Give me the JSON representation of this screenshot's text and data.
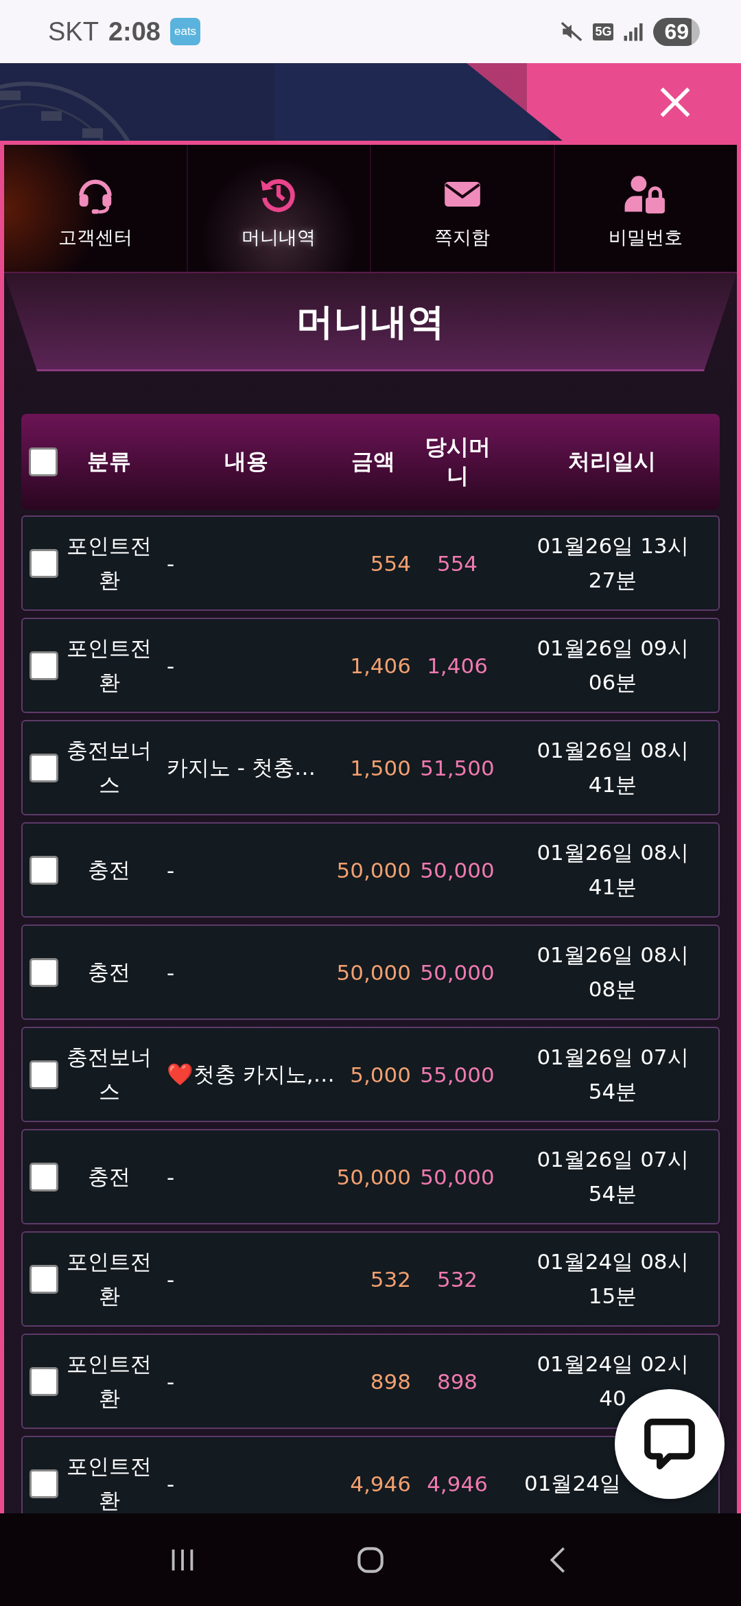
{
  "status_bar": {
    "carrier": "SKT",
    "time": "2:08",
    "app_badge": "eats",
    "network": "5G",
    "battery": "69"
  },
  "menu": [
    {
      "label": "고객센터",
      "selected": false
    },
    {
      "label": "머니내역",
      "selected": true
    },
    {
      "label": "쪽지함",
      "selected": false
    },
    {
      "label": "비밀번호",
      "selected": false
    }
  ],
  "title": "머니내역",
  "table": {
    "select_all": {
      "checked": false
    },
    "columns": [
      "분류",
      "내용",
      "금액",
      "당시머니",
      "처리일시"
    ],
    "rows": [
      {
        "checked": false,
        "category": "포인트전환",
        "content": "-",
        "amount": "554",
        "balance": "554",
        "datetime": "01월26일 13시27분"
      },
      {
        "checked": false,
        "category": "포인트전환",
        "content": "-",
        "amount": "1,406",
        "balance": "1,406",
        "datetime": "01월26일 09시06분"
      },
      {
        "checked": false,
        "category": "충전보너스",
        "content": "카지노 - 첫충…",
        "amount": "1,500",
        "balance": "51,500",
        "datetime": "01월26일 08시41분"
      },
      {
        "checked": false,
        "category": "충전",
        "content": "-",
        "amount": "50,000",
        "balance": "50,000",
        "datetime": "01월26일 08시41분"
      },
      {
        "checked": false,
        "category": "충전",
        "content": "-",
        "amount": "50,000",
        "balance": "50,000",
        "datetime": "01월26일 08시08분"
      },
      {
        "checked": false,
        "category": "충전보너스",
        "content": "❤️첫충 카지노,…",
        "amount": "5,000",
        "balance": "55,000",
        "datetime": "01월26일 07시54분"
      },
      {
        "checked": false,
        "category": "충전",
        "content": "-",
        "amount": "50,000",
        "balance": "50,000",
        "datetime": "01월26일 07시54분"
      },
      {
        "checked": false,
        "category": "포인트전환",
        "content": "-",
        "amount": "532",
        "balance": "532",
        "datetime": "01월24일 08시15분"
      },
      {
        "checked": false,
        "category": "포인트전환",
        "content": "-",
        "amount": "898",
        "balance": "898",
        "datetime": "01월24일 02시40"
      },
      {
        "checked": false,
        "category": "포인트전환",
        "content": "-",
        "amount": "4,946",
        "balance": "4,946",
        "datetime": "01월24일"
      }
    ]
  }
}
